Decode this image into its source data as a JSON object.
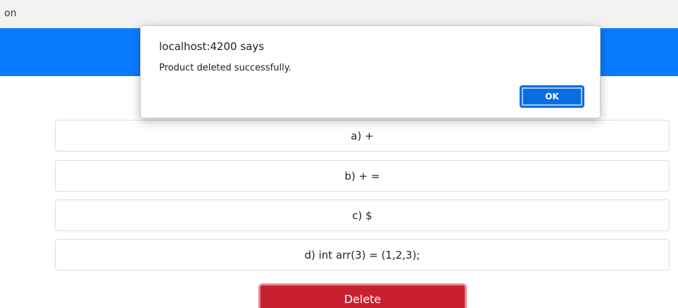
{
  "browser": {
    "partial_text": "on"
  },
  "dialog": {
    "title": "localhost:4200 says",
    "message": "Product deleted successfully.",
    "ok_label": "OK"
  },
  "question": {
    "options": [
      {
        "label": "a) +"
      },
      {
        "label": "b) + ="
      },
      {
        "label": "c) $"
      },
      {
        "label": "d) int arr(3) = (1,2,3);"
      }
    ]
  },
  "actions": {
    "delete_label": "Delete"
  },
  "colors": {
    "header_blue": "#0a7bff",
    "delete_red": "#c8202e",
    "ok_blue": "#0a6de0"
  }
}
